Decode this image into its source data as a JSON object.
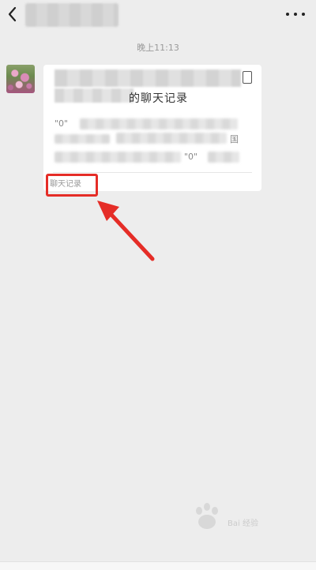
{
  "header": {
    "back_icon": "chevron-left-icon",
    "chat_title": "",
    "more_icon": "more-dots-icon"
  },
  "conversation": {
    "timestamp": "晚上11:13",
    "message": {
      "type": "forwarded-chat-record",
      "card_title_suffix": "的聊天记录",
      "preview_lines": [
        "\"0\"",
        "国",
        "\"0\""
      ],
      "footer_label": "聊天记录"
    }
  },
  "annotation": {
    "highlight_color": "#e52d27",
    "arrow_color": "#e52d27"
  },
  "watermark": {
    "text": "Bai 经验",
    "subtext": "jingyan.baidu.com"
  },
  "colors": {
    "background": "#ededed",
    "card": "#ffffff",
    "accent_red": "#e52d27"
  }
}
